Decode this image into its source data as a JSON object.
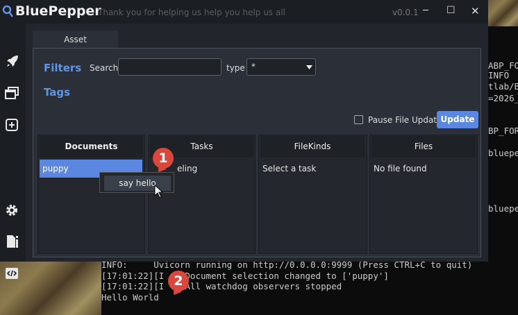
{
  "app": {
    "name": "BluePepper",
    "tagline": "Thank you for helping us help you help us all",
    "version": "v0.0.1",
    "window_controls": {
      "minimize": "─",
      "maximize": "☐",
      "close": "✕"
    }
  },
  "sidebar": {
    "items": [
      {
        "icon": "rocket-icon"
      },
      {
        "icon": "windows-icon"
      },
      {
        "icon": "add-icon"
      },
      {
        "icon": "gear-icon"
      },
      {
        "icon": "file-info-icon"
      },
      {
        "icon": "code-icon"
      }
    ]
  },
  "tabs": [
    {
      "label": "Asset"
    }
  ],
  "filters": {
    "title": "Filters",
    "search_label": "Search",
    "search_value": "",
    "type_label": "type",
    "type_value": "*"
  },
  "tags": {
    "title": "Tags"
  },
  "controls": {
    "pause_label": "Pause File Update",
    "pause_checked": false,
    "update_label": "Update"
  },
  "columns": [
    {
      "header": "Documents",
      "items": [
        "puppy"
      ]
    },
    {
      "header": "Tasks",
      "items": [
        "eling"
      ]
    },
    {
      "header": "FileKinds",
      "items": [
        "Select a task"
      ]
    },
    {
      "header": "Files",
      "items": [
        "No file found"
      ]
    }
  ],
  "context_menu": {
    "items": [
      "say hello"
    ]
  },
  "annotations": [
    "1",
    "2"
  ],
  "terminal": {
    "right_lines": [
      "ABP_FOR",
      "INFO",
      "tlab/B",
      "=2026_",
      "BP_FOR",
      "bluepe",
      "bluepe"
    ],
    "bottom_lines": [
      "INFO:     Uvicorn running on http://0.0.0.0:9999 (Press CTRL+C to quit)",
      "[17:01:22][I  ] Document selection changed to ['puppy']",
      "[17:01:22][I  ] All watchdog observers stopped",
      "Hello World"
    ]
  },
  "colors": {
    "accent": "#5b87e0",
    "selected": "#5b87e0",
    "badge": "#d9473d"
  }
}
